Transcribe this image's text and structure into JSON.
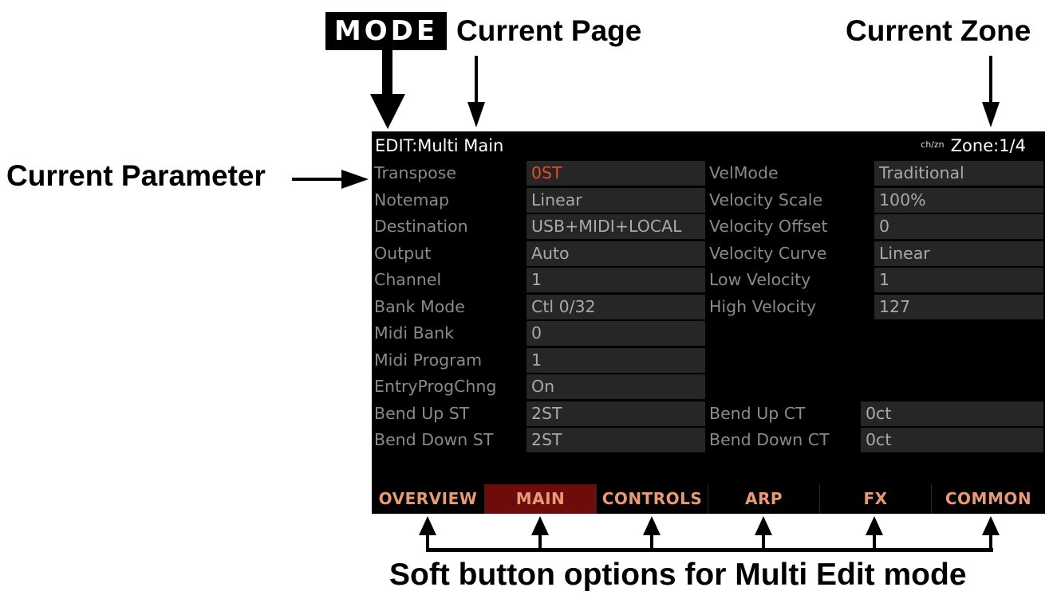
{
  "annotations": {
    "mode_badge": "MODE",
    "current_page": "Current Page",
    "current_zone": "Current Zone",
    "current_parameter": "Current Parameter",
    "softbutton_caption": "Soft button options for Multi Edit mode"
  },
  "screen": {
    "title": "EDIT:Multi Main",
    "chzn_icon": "ch/zn",
    "zone": "Zone:1/4",
    "rows": [
      {
        "l1": "Transpose",
        "v1": "0ST",
        "l2": "VelMode",
        "v2": "Traditional"
      },
      {
        "l1": "Notemap",
        "v1": "Linear",
        "l2": "Velocity Scale",
        "v2": "100%"
      },
      {
        "l1": "Destination",
        "v1": "USB+MIDI+LOCAL",
        "l2": "Velocity Offset",
        "v2": "0"
      },
      {
        "l1": "Output",
        "v1": "Auto",
        "l2": "Velocity Curve",
        "v2": "Linear"
      },
      {
        "l1": "Channel",
        "v1": "1",
        "l2": "Low Velocity",
        "v2": "1"
      },
      {
        "l1": "Bank Mode",
        "v1": "Ctl 0/32",
        "l2": "High Velocity",
        "v2": "127"
      },
      {
        "l1": "Midi Bank",
        "v1": "0"
      },
      {
        "l1": "Midi Program",
        "v1": "1"
      },
      {
        "l1": "EntryProgChng",
        "v1": "On"
      },
      {
        "l1": "Bend Up ST",
        "v1": "2ST",
        "l2": "Bend Up CT",
        "v2": "0ct"
      },
      {
        "l1": "Bend Down ST",
        "v1": "2ST",
        "l2": "Bend Down CT",
        "v2": "0ct"
      }
    ],
    "soft_buttons": [
      "OVERVIEW",
      "MAIN",
      "CONTROLS",
      "ARP",
      "FX",
      "COMMON"
    ],
    "selected_soft_button": "MAIN",
    "active_value_color": "#e84a2a",
    "soft_button_color": "#e89a74",
    "selected_soft_button_bg": "#6e0c0c"
  }
}
